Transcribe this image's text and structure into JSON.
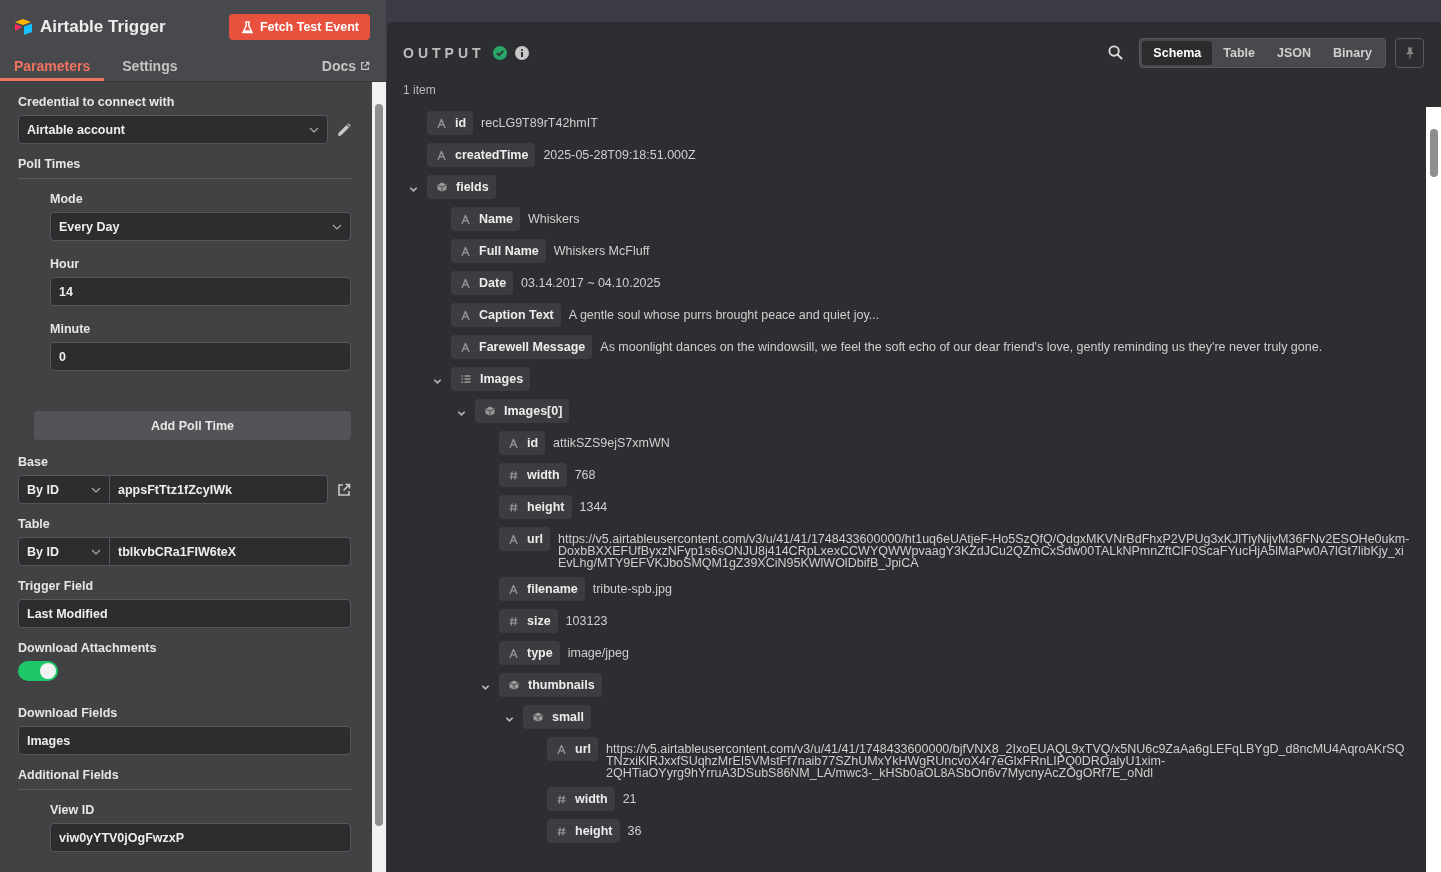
{
  "node": {
    "title": "Airtable Trigger",
    "fetch_button": "Fetch Test Event"
  },
  "tabs": [
    {
      "label": "Parameters",
      "selected": true
    },
    {
      "label": "Settings",
      "selected": false
    }
  ],
  "docs_link": "Docs",
  "parameters": [
    {
      "kind": "credential",
      "label": "Credential to connect with",
      "value": "Airtable account"
    },
    {
      "kind": "section",
      "label": "Poll Times",
      "add_button": "Add Poll Time",
      "children": [
        {
          "kind": "select",
          "label": "Mode",
          "value": "Every Day"
        },
        {
          "kind": "input",
          "label": "Hour",
          "value": "14"
        },
        {
          "kind": "input",
          "label": "Minute",
          "value": "0"
        }
      ]
    },
    {
      "kind": "locator",
      "label": "Base",
      "mode": "By ID",
      "value": "appsFtTtz1fZcyIWk",
      "external_link": true
    },
    {
      "kind": "locator",
      "label": "Table",
      "mode": "By ID",
      "value": "tblkvbCRa1FIW6teX",
      "external_link": false
    },
    {
      "kind": "input",
      "label": "Trigger Field",
      "value": "Last Modified"
    },
    {
      "kind": "toggle",
      "label": "Download Attachments",
      "on": true
    },
    {
      "kind": "input",
      "label": "Download Fields",
      "value": "Images"
    },
    {
      "kind": "section",
      "label": "Additional Fields",
      "children": [
        {
          "kind": "input",
          "label": "View ID",
          "value": "viw0yYTV0jOgFwzxP"
        }
      ]
    }
  ],
  "output": {
    "title": "OUTPUT",
    "succeeded": true,
    "count": "1 item",
    "views": [
      {
        "label": "Schema",
        "selected": true
      },
      {
        "label": "Table",
        "selected": false
      },
      {
        "label": "JSON",
        "selected": false
      },
      {
        "label": "Binary",
        "selected": false
      }
    ],
    "tree": [
      {
        "kind": "string",
        "key": "id",
        "value": "recLG9T89rT42hmIT"
      },
      {
        "kind": "string",
        "key": "createdTime",
        "value": "2025-05-28T09:18:51.000Z"
      },
      {
        "kind": "object",
        "key": "fields",
        "expanded": true,
        "children": [
          {
            "kind": "string",
            "key": "Name",
            "value": "Whiskers"
          },
          {
            "kind": "string",
            "key": "Full Name",
            "value": "Whiskers McFluff"
          },
          {
            "kind": "string",
            "key": "Date",
            "value": "03.14.2017 ~ 04.10.2025"
          },
          {
            "kind": "string",
            "key": "Caption Text",
            "value": "A gentle soul whose purrs brought peace and quiet joy..."
          },
          {
            "kind": "string",
            "key": "Farewell Message",
            "value": "As moonlight dances on the windowsill, we feel the soft echo of our dear friend's love, gently reminding us they're never truly gone."
          },
          {
            "kind": "array",
            "key": "Images",
            "expanded": true,
            "children": [
              {
                "kind": "object",
                "key": "Images[0]",
                "expanded": true,
                "children": [
                  {
                    "kind": "string",
                    "key": "id",
                    "value": "attikSZS9ejS7xmWN"
                  },
                  {
                    "kind": "number",
                    "key": "width",
                    "value": "768"
                  },
                  {
                    "kind": "number",
                    "key": "height",
                    "value": "1344"
                  },
                  {
                    "kind": "string",
                    "key": "url",
                    "value": "https://v5.airtableusercontent.com/v3/u/41/41/1748433600000/ht1uq6eUAtjeF-Ho5SzQfQ/QdgxMKVNrBdFhxP2VPUg3xKJlTiyNijvM36FNv2ESOHe0ukm-DoxbBXXEFUfByxzNFyp1s6sONJU8j414CRpLxexCCWYQWWpvaagY3KZdJCu2QZmCxSdw00TALkNPmnZftClF0ScaFYucHjA5lMaPw0A7lGt7libKjy_xiEvLhg/MTY9EFVKJboSMQM1gZ39XCiN95KWlWOlDbifB_JpiCA"
                  },
                  {
                    "kind": "string",
                    "key": "filename",
                    "value": "tribute-spb.jpg"
                  },
                  {
                    "kind": "number",
                    "key": "size",
                    "value": "103123"
                  },
                  {
                    "kind": "string",
                    "key": "type",
                    "value": "image/jpeg"
                  },
                  {
                    "kind": "object",
                    "key": "thumbnails",
                    "expanded": true,
                    "children": [
                      {
                        "kind": "object",
                        "key": "small",
                        "expanded": true,
                        "children": [
                          {
                            "kind": "string",
                            "key": "url",
                            "value": "https://v5.airtableusercontent.com/v3/u/41/41/1748433600000/bjfVNX8_2IxoEUAQL9xTVQ/x5NU6c9ZaAa6gLEFqLBYgD_d8ncMU4AqroAKrSQTNzxiKlRJxxfSUqhzMrEI5VMstFf7naib77SZhUMxYkHWgRUncvoX4r7eGlxFRnLIPQ0DROalyU1xim-2QHTiaOYyrg9hYrruA3DSubS86NM_LA/mwc3-_kHSb0aOL8ASbOn6v7MycnyAcZOgORf7E_oNdl"
                          },
                          {
                            "kind": "number",
                            "key": "width",
                            "value": "21"
                          },
                          {
                            "kind": "number",
                            "key": "height",
                            "value": "36"
                          }
                        ]
                      }
                    ]
                  }
                ]
              }
            ]
          }
        ]
      }
    ]
  }
}
